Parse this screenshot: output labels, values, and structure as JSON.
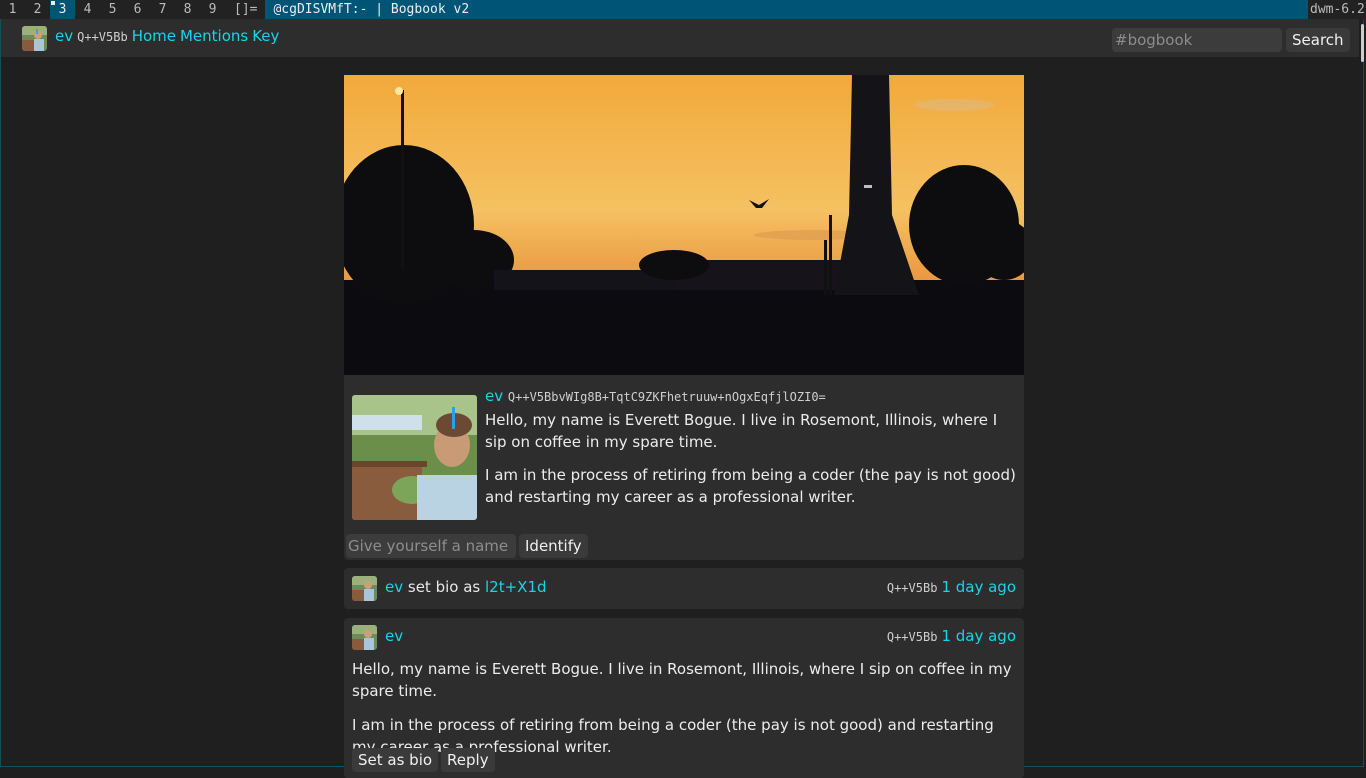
{
  "dwm": {
    "tags": [
      "1",
      "2",
      "3",
      "4",
      "5",
      "6",
      "7",
      "8",
      "9"
    ],
    "selected_tag": "3",
    "layout_symbol": "[]=",
    "window_title": "@cgDISVMfT:- | Bogbook v2",
    "status": "dwm-6.2"
  },
  "nav": {
    "user_name": "ev",
    "user_id": "Q++V5Bb",
    "home": "Home",
    "mentions": "Mentions",
    "key": "Key",
    "search_placeholder": "#bogbook",
    "search_button": "Search"
  },
  "profile": {
    "name": "ev",
    "full_key": "Q++V5BbvWIg8B+TqtC9ZKFhetruuw+nOgxEqfjlOZI0=",
    "bio_paragraphs": [
      "Hello, my name is Everett Bogue. I live in Rosemont, Illinois, where I sip on coffee in my spare time.",
      "I am in the process of retiring from being a coder (the pay is not good) and restarting my career as a professional writer."
    ],
    "name_placeholder": "Give yourself a name",
    "identify_button": "Identify"
  },
  "event": {
    "name": "ev",
    "action": "set bio as",
    "target": "l2t+X1d",
    "author_id": "Q++V5Bb",
    "time": "1 day ago"
  },
  "post": {
    "name": "ev",
    "author_id": "Q++V5Bb",
    "time": "1 day ago",
    "paragraphs": [
      "Hello, my name is Everett Bogue. I live in Rosemont, Illinois, where I sip on coffee in my spare time.",
      "I am in the process of retiring from being a coder (the pay is not good) and restarting my career as a professional writer."
    ],
    "set_bio_button": "Set as bio",
    "reply_button": "Reply"
  },
  "colors": {
    "accent_link": "#19d4e6",
    "dwm_selected": "#005577",
    "card_bg": "#2d2d2d",
    "page_bg": "#1f1f1f"
  }
}
